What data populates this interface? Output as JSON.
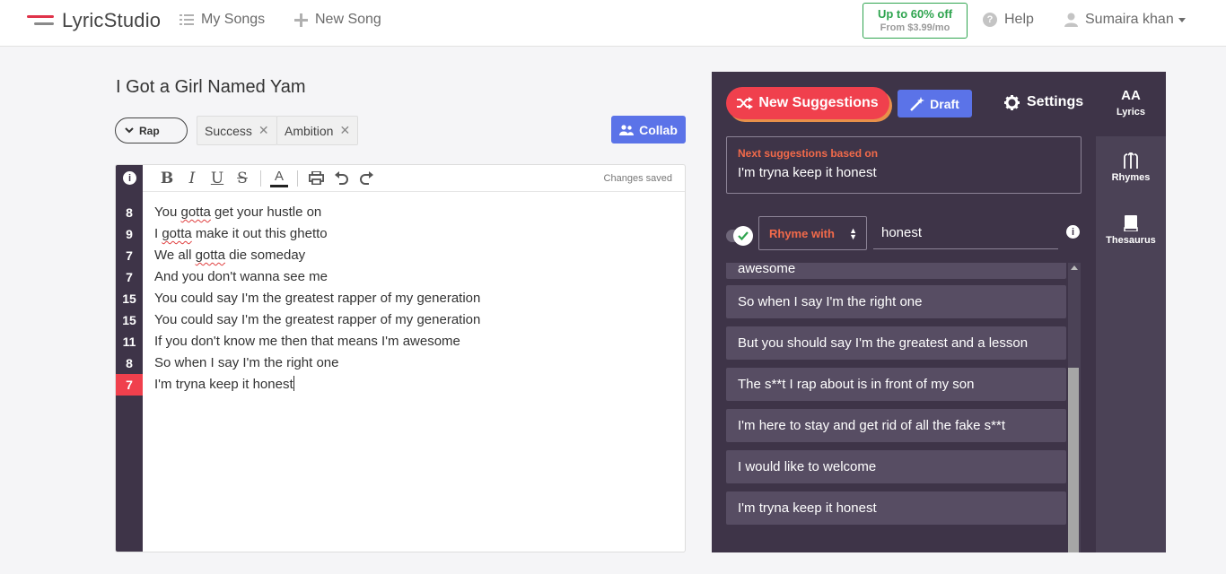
{
  "app": {
    "name": "LyricStudio"
  },
  "nav": {
    "my_songs": "My Songs",
    "new_song": "New Song"
  },
  "promo": {
    "line1": "Up to 60% off",
    "line2": "From $3.99/mo"
  },
  "help": "Help",
  "user": {
    "name": "Sumaira khan"
  },
  "song": {
    "title": "I Got a Girl Named Yam",
    "genre": "Rap",
    "tags": [
      "Success",
      "Ambition"
    ],
    "collab_label": "Collab"
  },
  "editor": {
    "status": "Changes saved",
    "toolbar": [
      "bold",
      "italic",
      "underline",
      "strikethrough",
      "text-color",
      "print",
      "undo",
      "redo"
    ],
    "lines": [
      {
        "syllables": "8",
        "parts": [
          "You ",
          "gotta",
          " get your hustle on"
        ],
        "misspelled": 1
      },
      {
        "syllables": "9",
        "parts": [
          "I ",
          "gotta",
          " make it out this ghetto"
        ],
        "misspelled": 1
      },
      {
        "syllables": "7",
        "parts": [
          "We all ",
          "gotta",
          " die someday"
        ],
        "misspelled": 1
      },
      {
        "syllables": "7",
        "parts": [
          "And you don't wanna see me"
        ]
      },
      {
        "syllables": "15",
        "parts": [
          "You could say I'm the greatest rapper of my generation"
        ]
      },
      {
        "syllables": "15",
        "parts": [
          "You could say I'm the greatest rapper of my generation"
        ]
      },
      {
        "syllables": "11",
        "parts": [
          "If you don't know me then that means I'm awesome"
        ]
      },
      {
        "syllables": "8",
        "parts": [
          "So when I say I'm the right one"
        ]
      },
      {
        "syllables": "7",
        "parts": [
          "I'm tryna keep it honest"
        ],
        "active": true
      }
    ]
  },
  "panel": {
    "new_suggestions": "New Suggestions",
    "draft": "Draft",
    "settings": "Settings",
    "based_label": "Next suggestions based on",
    "based_value": "I'm tryna keep it honest",
    "rhyme_mode": "Rhyme with",
    "rhyme_word": "honest",
    "suggestions": [
      "awesome",
      "So when I say I'm the right one",
      "But you should say I'm the greatest and a lesson",
      "The s**t I rap about is in front of my son",
      "I'm here to stay and get rid of all the fake s**t",
      "I would like to welcome",
      "I'm tryna keep it honest"
    ],
    "side_tabs": {
      "lyrics": "Lyrics",
      "rhymes": "Rhymes",
      "thesaurus": "Thesaurus",
      "font_glyph": "AA"
    }
  },
  "colors": {
    "accent_red": "#f0404d",
    "accent_blue": "#5b73e8",
    "panel_bg": "#3e3448",
    "promo_green": "#2fa44f"
  }
}
